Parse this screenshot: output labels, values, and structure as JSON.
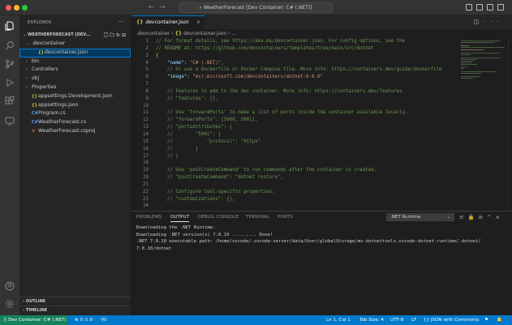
{
  "window": {
    "title": "WeatherForecast [Dev Container: C# (.NET)]",
    "traffic_lights": [
      "#ff5f57",
      "#febc2e",
      "#28c840"
    ]
  },
  "activity_bar": {
    "items": [
      "explorer-icon",
      "search-icon",
      "source-control-icon",
      "run-debug-icon",
      "extensions-icon",
      "remote-explorer-icon",
      "accounts-icon",
      "manage-icon"
    ]
  },
  "sidebar": {
    "title": "EXPLORER",
    "more": "···",
    "workspace": "WEATHERFORECAST [DEV...",
    "tree": [
      {
        "label": ".devcontainer",
        "chev": "⌄",
        "indent": 1,
        "icon": ""
      },
      {
        "label": "devcontainer.json",
        "chev": "",
        "indent": 2,
        "icon": "{}",
        "selected": true
      },
      {
        "label": "bin",
        "chev": "›",
        "indent": 1,
        "icon": ""
      },
      {
        "label": "Controllers",
        "chev": "›",
        "indent": 1,
        "icon": ""
      },
      {
        "label": "obj",
        "chev": "›",
        "indent": 1,
        "icon": ""
      },
      {
        "label": "Properties",
        "chev": "›",
        "indent": 1,
        "icon": ""
      },
      {
        "label": "appsettings.Development.json",
        "chev": "",
        "indent": 1,
        "icon": "{}"
      },
      {
        "label": "appsettings.json",
        "chev": "",
        "indent": 1,
        "icon": "{}"
      },
      {
        "label": "Program.cs",
        "chev": "",
        "indent": 1,
        "icon": "C#"
      },
      {
        "label": "WeatherForecast.cs",
        "chev": "",
        "indent": 1,
        "icon": "C#"
      },
      {
        "label": "WeatherForecast.csproj",
        "chev": "",
        "indent": 1,
        "icon": "⚙"
      }
    ],
    "outline": "OUTLINE",
    "timeline": "TIMELINE"
  },
  "editor": {
    "tab_label": "devcontainer.json",
    "tab_icon": "{}",
    "breadcrumb": [
      ".devcontainer",
      "devcontainer.json",
      "..."
    ],
    "lines": [
      {
        "n": "1",
        "t": "comment",
        "text": "// For format details, see https://aka.ms/devcontainer.json. For config options, see the"
      },
      {
        "n": "2",
        "t": "comment",
        "text": "// README at: https://github.com/devcontainers/templates/tree/main/src/dotnet"
      },
      {
        "n": "3",
        "t": "brace",
        "text": "{"
      },
      {
        "n": "4",
        "t": "kv",
        "key": "\"name\"",
        "val": "\"C# (.NET)\","
      },
      {
        "n": "5",
        "t": "comment",
        "text": "    // Or use a Dockerfile or Docker Compose file. More info: https://containers.dev/guide/dockerfile"
      },
      {
        "n": "6",
        "t": "kv",
        "key": "\"image\"",
        "val": "\"mcr.microsoft.com/devcontainers/dotnet:0-6.0\""
      },
      {
        "n": "7",
        "t": "blank",
        "text": ""
      },
      {
        "n": "8",
        "t": "comment",
        "text": "    // Features to add to the dev container. More info: https://containers.dev/features."
      },
      {
        "n": "9",
        "t": "comment",
        "text": "    // \"features\": {},"
      },
      {
        "n": "10",
        "t": "blank",
        "text": ""
      },
      {
        "n": "11",
        "t": "comment",
        "text": "    // Use 'forwardPorts' to make a list of ports inside the container available locally."
      },
      {
        "n": "12",
        "t": "comment",
        "text": "    // \"forwardPorts\": [5000, 5001],"
      },
      {
        "n": "13",
        "t": "comment",
        "text": "    // \"portsAttributes\": {"
      },
      {
        "n": "14",
        "t": "comment",
        "text": "    //        \"5001\": {"
      },
      {
        "n": "15",
        "t": "comment",
        "text": "    //            \"protocol\": \"https\""
      },
      {
        "n": "16",
        "t": "comment",
        "text": "    //        }"
      },
      {
        "n": "17",
        "t": "comment",
        "text": "    // }"
      },
      {
        "n": "18",
        "t": "blank",
        "text": ""
      },
      {
        "n": "19",
        "t": "comment",
        "text": "    // Use 'postCreateCommand' to run commands after the container is created."
      },
      {
        "n": "20",
        "t": "comment",
        "text": "    // \"postCreateCommand\": \"dotnet restore\","
      },
      {
        "n": "21",
        "t": "blank",
        "text": ""
      },
      {
        "n": "22",
        "t": "comment",
        "text": "    // Configure tool-specific properties."
      },
      {
        "n": "23",
        "t": "comment",
        "text": "    // \"customizations\": {},"
      },
      {
        "n": "24",
        "t": "blank",
        "text": ""
      }
    ]
  },
  "panel": {
    "tabs": [
      "PROBLEMS",
      "OUTPUT",
      "DEBUG CONSOLE",
      "TERMINAL",
      "PORTS"
    ],
    "active_tab": "OUTPUT",
    "channel": ".NET Runtime",
    "output": [
      "Downloading the .NET Runtime.",
      "Downloading .NET version(s) 7.0.10 ......... Done!",
      ".NET 7.0.10 executable path: /home/vscode/.vscode-server/data/User/globalStorage/ms-dotnettools.vscode-dotnet-runtime/.dotnet/",
      "7.0.10/dotnet"
    ]
  },
  "statusbar": {
    "remote": "Dev Container: C# (.NET)",
    "problems": "⊗ 0 ⚠ 0",
    "ports": "⚲0",
    "position": "Ln 1, Col 1",
    "tab_size": "Tab Size: 4",
    "encoding": "UTF-8",
    "eol": "LF",
    "language": "{} JSON with Comments",
    "colors": {
      "bar": "#007acc",
      "remote": "#16825d"
    }
  }
}
